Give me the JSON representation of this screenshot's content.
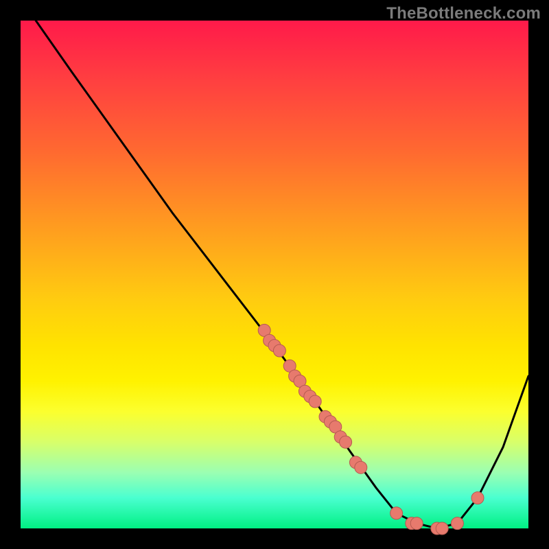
{
  "watermark": "TheBottleneck.com",
  "colors": {
    "curve": "#000000",
    "marker_fill": "#e77a6d",
    "marker_stroke": "#b55a50"
  },
  "chart_data": {
    "type": "line",
    "title": "",
    "xlabel": "",
    "ylabel": "",
    "xlim": [
      0,
      100
    ],
    "ylim": [
      0,
      100
    ],
    "series": [
      {
        "name": "bottleneck-curve",
        "x": [
          3,
          10,
          20,
          30,
          40,
          50,
          58,
          65,
          70,
          74,
          78,
          82,
          86,
          90,
          95,
          100
        ],
        "y": [
          100,
          90,
          76,
          62,
          49,
          36,
          25,
          15,
          8,
          3,
          1,
          0,
          1,
          6,
          16,
          30
        ]
      }
    ],
    "markers": [
      {
        "x": 48,
        "y": 39
      },
      {
        "x": 49,
        "y": 37
      },
      {
        "x": 50,
        "y": 36
      },
      {
        "x": 51,
        "y": 35
      },
      {
        "x": 53,
        "y": 32
      },
      {
        "x": 54,
        "y": 30
      },
      {
        "x": 55,
        "y": 29
      },
      {
        "x": 56,
        "y": 27
      },
      {
        "x": 57,
        "y": 26
      },
      {
        "x": 58,
        "y": 25
      },
      {
        "x": 60,
        "y": 22
      },
      {
        "x": 61,
        "y": 21
      },
      {
        "x": 62,
        "y": 20
      },
      {
        "x": 63,
        "y": 18
      },
      {
        "x": 64,
        "y": 17
      },
      {
        "x": 66,
        "y": 13
      },
      {
        "x": 67,
        "y": 12
      },
      {
        "x": 74,
        "y": 3
      },
      {
        "x": 77,
        "y": 1
      },
      {
        "x": 78,
        "y": 1
      },
      {
        "x": 82,
        "y": 0
      },
      {
        "x": 83,
        "y": 0
      },
      {
        "x": 86,
        "y": 1
      },
      {
        "x": 90,
        "y": 6
      }
    ]
  }
}
